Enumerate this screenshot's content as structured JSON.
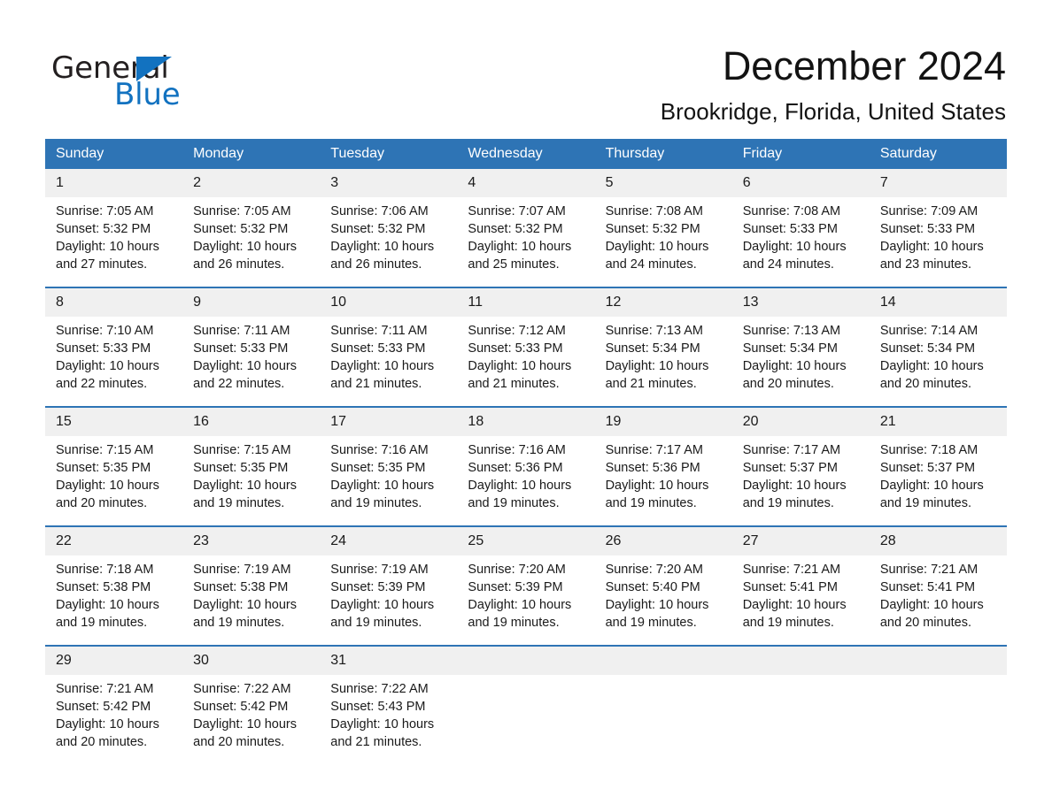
{
  "brand": {
    "name_part1": "General",
    "name_part2": "Blue",
    "accent_color": "#1272c0"
  },
  "header": {
    "month_title": "December 2024",
    "location": "Brookridge, Florida, United States"
  },
  "theme": {
    "header_blue": "#2e74b5",
    "daynum_band": "#f0f0f0",
    "text": "#1a1a1a"
  },
  "calendar": {
    "weekday_headers": [
      "Sunday",
      "Monday",
      "Tuesday",
      "Wednesday",
      "Thursday",
      "Friday",
      "Saturday"
    ],
    "weeks": [
      [
        {
          "day": "1",
          "sunrise": "Sunrise: 7:05 AM",
          "sunset": "Sunset: 5:32 PM",
          "daylight": "Daylight: 10 hours and 27 minutes."
        },
        {
          "day": "2",
          "sunrise": "Sunrise: 7:05 AM",
          "sunset": "Sunset: 5:32 PM",
          "daylight": "Daylight: 10 hours and 26 minutes."
        },
        {
          "day": "3",
          "sunrise": "Sunrise: 7:06 AM",
          "sunset": "Sunset: 5:32 PM",
          "daylight": "Daylight: 10 hours and 26 minutes."
        },
        {
          "day": "4",
          "sunrise": "Sunrise: 7:07 AM",
          "sunset": "Sunset: 5:32 PM",
          "daylight": "Daylight: 10 hours and 25 minutes."
        },
        {
          "day": "5",
          "sunrise": "Sunrise: 7:08 AM",
          "sunset": "Sunset: 5:32 PM",
          "daylight": "Daylight: 10 hours and 24 minutes."
        },
        {
          "day": "6",
          "sunrise": "Sunrise: 7:08 AM",
          "sunset": "Sunset: 5:33 PM",
          "daylight": "Daylight: 10 hours and 24 minutes."
        },
        {
          "day": "7",
          "sunrise": "Sunrise: 7:09 AM",
          "sunset": "Sunset: 5:33 PM",
          "daylight": "Daylight: 10 hours and 23 minutes."
        }
      ],
      [
        {
          "day": "8",
          "sunrise": "Sunrise: 7:10 AM",
          "sunset": "Sunset: 5:33 PM",
          "daylight": "Daylight: 10 hours and 22 minutes."
        },
        {
          "day": "9",
          "sunrise": "Sunrise: 7:11 AM",
          "sunset": "Sunset: 5:33 PM",
          "daylight": "Daylight: 10 hours and 22 minutes."
        },
        {
          "day": "10",
          "sunrise": "Sunrise: 7:11 AM",
          "sunset": "Sunset: 5:33 PM",
          "daylight": "Daylight: 10 hours and 21 minutes."
        },
        {
          "day": "11",
          "sunrise": "Sunrise: 7:12 AM",
          "sunset": "Sunset: 5:33 PM",
          "daylight": "Daylight: 10 hours and 21 minutes."
        },
        {
          "day": "12",
          "sunrise": "Sunrise: 7:13 AM",
          "sunset": "Sunset: 5:34 PM",
          "daylight": "Daylight: 10 hours and 21 minutes."
        },
        {
          "day": "13",
          "sunrise": "Sunrise: 7:13 AM",
          "sunset": "Sunset: 5:34 PM",
          "daylight": "Daylight: 10 hours and 20 minutes."
        },
        {
          "day": "14",
          "sunrise": "Sunrise: 7:14 AM",
          "sunset": "Sunset: 5:34 PM",
          "daylight": "Daylight: 10 hours and 20 minutes."
        }
      ],
      [
        {
          "day": "15",
          "sunrise": "Sunrise: 7:15 AM",
          "sunset": "Sunset: 5:35 PM",
          "daylight": "Daylight: 10 hours and 20 minutes."
        },
        {
          "day": "16",
          "sunrise": "Sunrise: 7:15 AM",
          "sunset": "Sunset: 5:35 PM",
          "daylight": "Daylight: 10 hours and 19 minutes."
        },
        {
          "day": "17",
          "sunrise": "Sunrise: 7:16 AM",
          "sunset": "Sunset: 5:35 PM",
          "daylight": "Daylight: 10 hours and 19 minutes."
        },
        {
          "day": "18",
          "sunrise": "Sunrise: 7:16 AM",
          "sunset": "Sunset: 5:36 PM",
          "daylight": "Daylight: 10 hours and 19 minutes."
        },
        {
          "day": "19",
          "sunrise": "Sunrise: 7:17 AM",
          "sunset": "Sunset: 5:36 PM",
          "daylight": "Daylight: 10 hours and 19 minutes."
        },
        {
          "day": "20",
          "sunrise": "Sunrise: 7:17 AM",
          "sunset": "Sunset: 5:37 PM",
          "daylight": "Daylight: 10 hours and 19 minutes."
        },
        {
          "day": "21",
          "sunrise": "Sunrise: 7:18 AM",
          "sunset": "Sunset: 5:37 PM",
          "daylight": "Daylight: 10 hours and 19 minutes."
        }
      ],
      [
        {
          "day": "22",
          "sunrise": "Sunrise: 7:18 AM",
          "sunset": "Sunset: 5:38 PM",
          "daylight": "Daylight: 10 hours and 19 minutes."
        },
        {
          "day": "23",
          "sunrise": "Sunrise: 7:19 AM",
          "sunset": "Sunset: 5:38 PM",
          "daylight": "Daylight: 10 hours and 19 minutes."
        },
        {
          "day": "24",
          "sunrise": "Sunrise: 7:19 AM",
          "sunset": "Sunset: 5:39 PM",
          "daylight": "Daylight: 10 hours and 19 minutes."
        },
        {
          "day": "25",
          "sunrise": "Sunrise: 7:20 AM",
          "sunset": "Sunset: 5:39 PM",
          "daylight": "Daylight: 10 hours and 19 minutes."
        },
        {
          "day": "26",
          "sunrise": "Sunrise: 7:20 AM",
          "sunset": "Sunset: 5:40 PM",
          "daylight": "Daylight: 10 hours and 19 minutes."
        },
        {
          "day": "27",
          "sunrise": "Sunrise: 7:21 AM",
          "sunset": "Sunset: 5:41 PM",
          "daylight": "Daylight: 10 hours and 19 minutes."
        },
        {
          "day": "28",
          "sunrise": "Sunrise: 7:21 AM",
          "sunset": "Sunset: 5:41 PM",
          "daylight": "Daylight: 10 hours and 20 minutes."
        }
      ],
      [
        {
          "day": "29",
          "sunrise": "Sunrise: 7:21 AM",
          "sunset": "Sunset: 5:42 PM",
          "daylight": "Daylight: 10 hours and 20 minutes."
        },
        {
          "day": "30",
          "sunrise": "Sunrise: 7:22 AM",
          "sunset": "Sunset: 5:42 PM",
          "daylight": "Daylight: 10 hours and 20 minutes."
        },
        {
          "day": "31",
          "sunrise": "Sunrise: 7:22 AM",
          "sunset": "Sunset: 5:43 PM",
          "daylight": "Daylight: 10 hours and 21 minutes."
        },
        {
          "day": "",
          "sunrise": "",
          "sunset": "",
          "daylight": ""
        },
        {
          "day": "",
          "sunrise": "",
          "sunset": "",
          "daylight": ""
        },
        {
          "day": "",
          "sunrise": "",
          "sunset": "",
          "daylight": ""
        },
        {
          "day": "",
          "sunrise": "",
          "sunset": "",
          "daylight": ""
        }
      ]
    ]
  }
}
